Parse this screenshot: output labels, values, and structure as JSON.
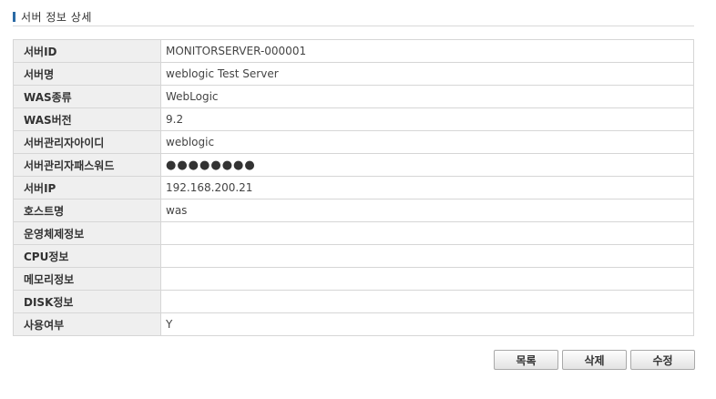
{
  "section": {
    "title": "서버 정보 상세"
  },
  "rows": [
    {
      "label": "서버ID",
      "value": "MONITORSERVER-000001"
    },
    {
      "label": "서버명",
      "value": "weblogic Test Server"
    },
    {
      "label": "WAS종류",
      "value": "WebLogic"
    },
    {
      "label": "WAS버전",
      "value": "9.2"
    },
    {
      "label": "서버관리자아이디",
      "value": "weblogic"
    },
    {
      "label": "서버관리자패스워드",
      "value": "●●●●●●●●"
    },
    {
      "label": "서버IP",
      "value": "192.168.200.21"
    },
    {
      "label": "호스트명",
      "value": "was"
    },
    {
      "label": "운영체제정보",
      "value": ""
    },
    {
      "label": "CPU정보",
      "value": ""
    },
    {
      "label": "메모리정보",
      "value": ""
    },
    {
      "label": "DISK정보",
      "value": ""
    },
    {
      "label": "사용여부",
      "value": "Y"
    }
  ],
  "buttons": {
    "list": "목록",
    "delete": "삭제",
    "edit": "수정"
  },
  "colors": {
    "accent": "#2a6aa5",
    "label_bg": "#efefef",
    "border": "#d6d6d6"
  }
}
